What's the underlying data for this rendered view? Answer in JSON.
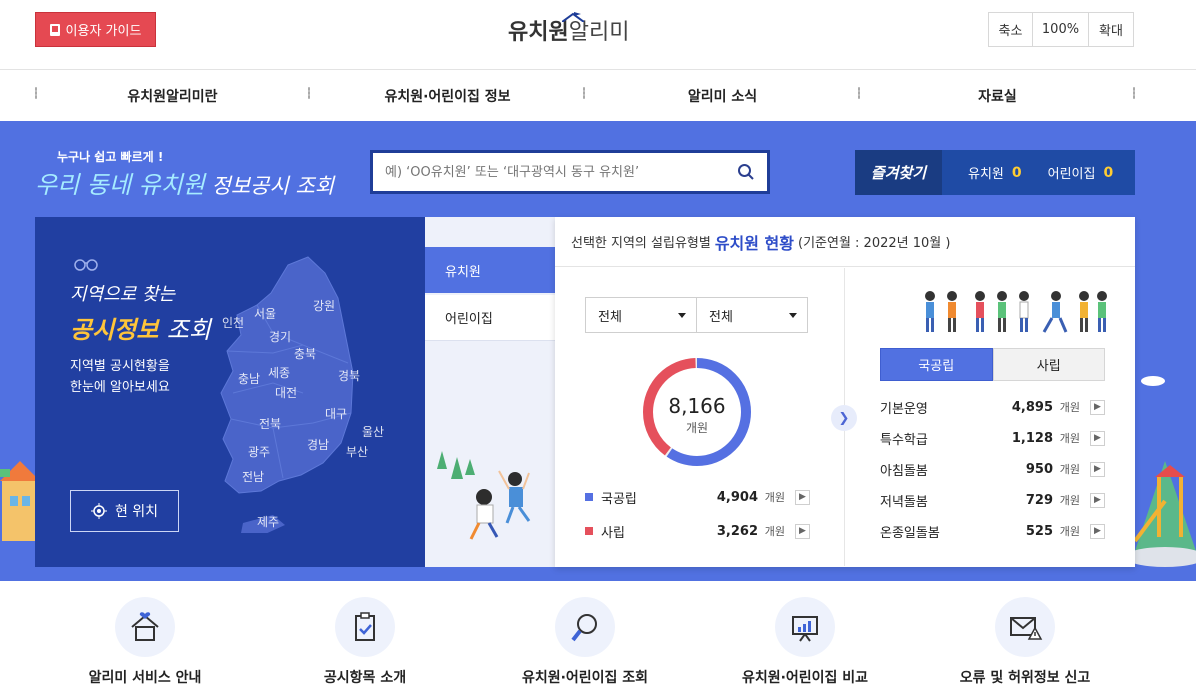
{
  "header": {
    "guide_label": "이용자 가이드",
    "logo_bold": "유치원",
    "logo_light": "알리미",
    "zoom_out": "축소",
    "zoom_level": "100%",
    "zoom_in": "확대"
  },
  "nav": {
    "items": [
      "유치원알리미란",
      "유치원·어린이집 정보",
      "알리미 소식",
      "자료실"
    ]
  },
  "hero": {
    "subtitle": "누구나 쉽고 빠르게 !",
    "title_hl": "우리 동네 유치원",
    "title_rest": "정보공시 조회",
    "search_placeholder": "예) ‘OO유치원’ 또는 ‘대구광역시 동구 유치원’",
    "fav_title": "즐겨찾기",
    "fav_kinder_label": "유치원",
    "fav_kinder_count": "0",
    "fav_daycare_label": "어린이집",
    "fav_daycare_count": "0"
  },
  "map": {
    "title_line1": "지역으로 찾는",
    "title_hl": "공시정보",
    "title_rest": "조회",
    "desc_line1": "지역별 공시현황을",
    "desc_line2": "한눈에 알아보세요",
    "location_button": "현 위치",
    "regions": [
      "인천",
      "서울",
      "강원",
      "경기",
      "충북",
      "충남",
      "세종",
      "대전",
      "경북",
      "대구",
      "전북",
      "울산",
      "광주",
      "경남",
      "부산",
      "전남",
      "제주"
    ]
  },
  "tabs": [
    "유치원",
    "어린이집"
  ],
  "stats": {
    "head_prefix": "선택한 지역의 설립유형별",
    "head_strong": "유치원 현황",
    "head_suffix": "(기준연월 : 2022년 10월 )",
    "select1": "전체",
    "select2": "전체",
    "total": "8,166",
    "total_unit": "개원",
    "legend": [
      {
        "label": "국공립",
        "value": "4,904",
        "unit": "개원",
        "color": "#5570e2"
      },
      {
        "label": "사립",
        "value": "3,262",
        "unit": "개원",
        "color": "#e5505c"
      }
    ],
    "right_tabs": [
      "국공립",
      "사립"
    ],
    "services": [
      {
        "label": "기본운영",
        "value": "4,895",
        "unit": "개원"
      },
      {
        "label": "특수학급",
        "value": "1,128",
        "unit": "개원"
      },
      {
        "label": "아침돌봄",
        "value": "950",
        "unit": "개원"
      },
      {
        "label": "저녁돌봄",
        "value": "729",
        "unit": "개원"
      },
      {
        "label": "온종일돌봄",
        "value": "525",
        "unit": "개원"
      }
    ]
  },
  "chart_data": {
    "type": "pie",
    "categories": [
      "국공립",
      "사립"
    ],
    "values": [
      4904,
      3262
    ],
    "title": "",
    "total": 8166
  },
  "quick_links": [
    "알리미 서비스 안내",
    "공시항목 소개",
    "유치원·어린이집 조회",
    "유치원·어린이집 비교",
    "오류 및 허위정보 신고"
  ],
  "colors": {
    "hero_bg": "#5171e1",
    "map_bg": "#213fa1",
    "accent_red": "#e54952",
    "accent_blue": "#2e4dc8",
    "highlight_yellow": "#ffc53a"
  }
}
